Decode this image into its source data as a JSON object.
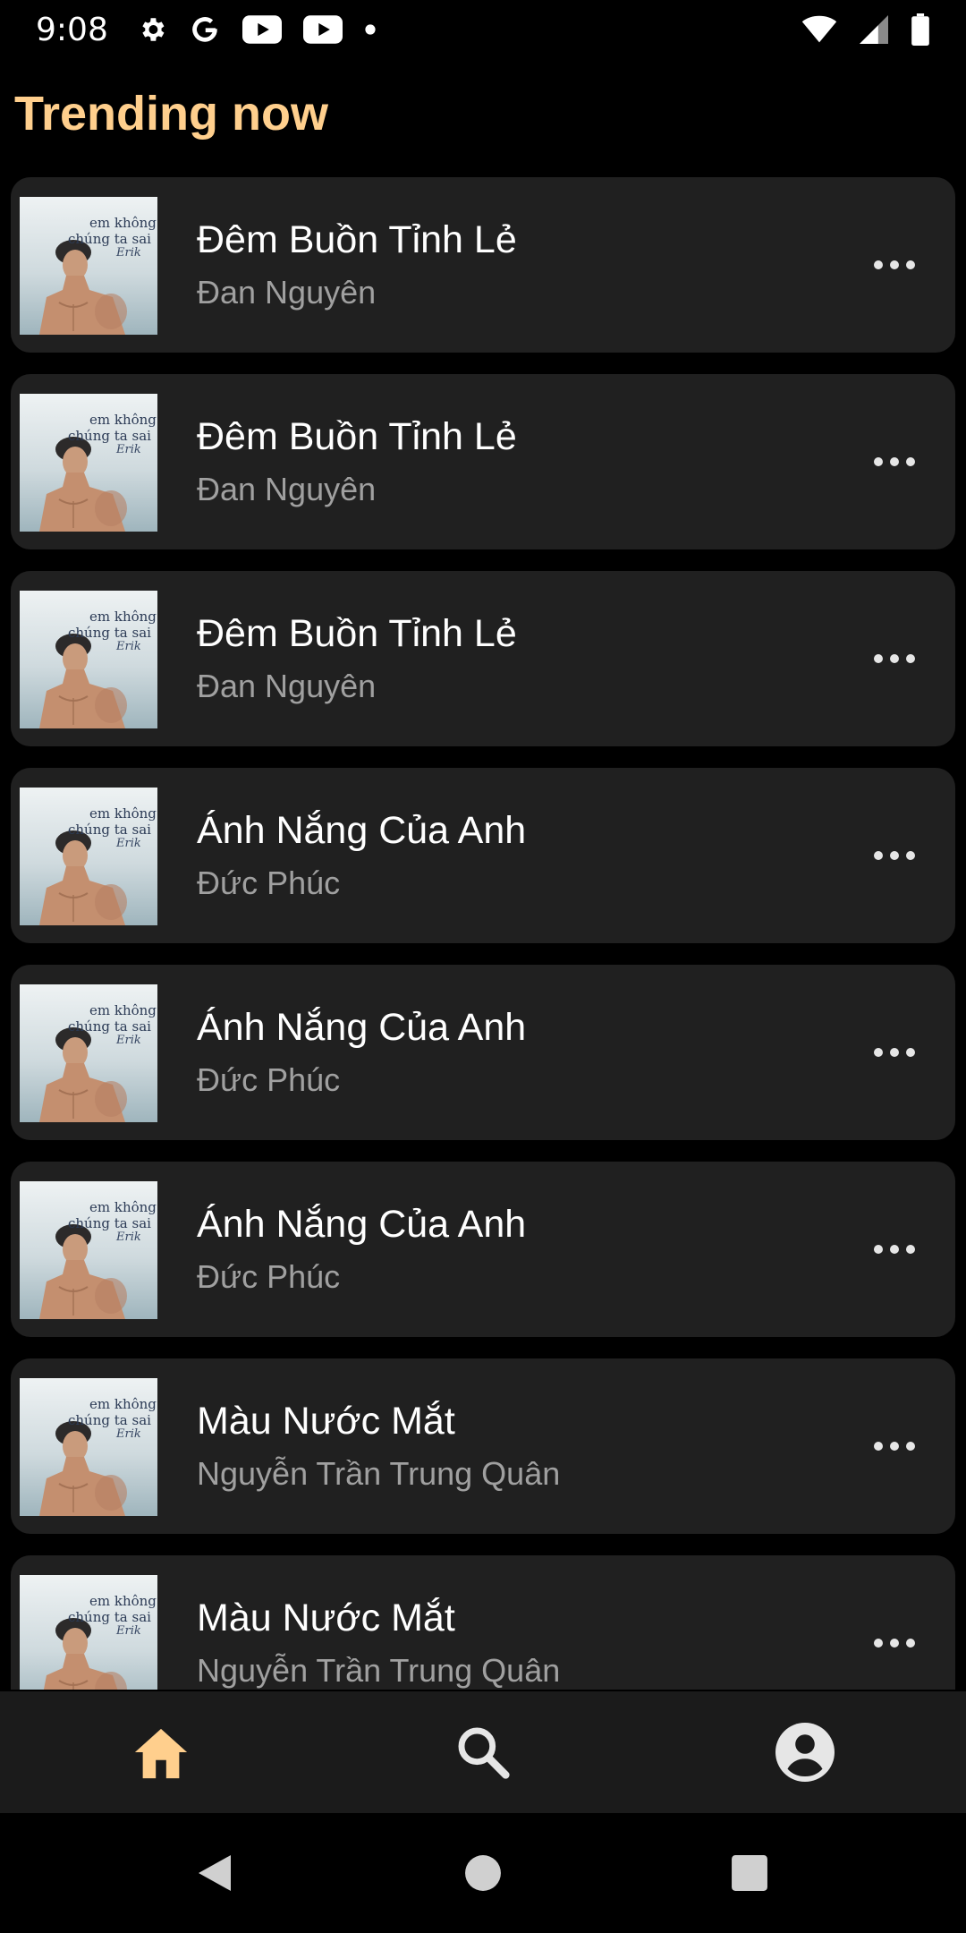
{
  "status_bar": {
    "time": "9:08",
    "icons_left": [
      "gear-icon",
      "google-icon",
      "youtube-icon",
      "youtube-icon",
      "dot-icon"
    ],
    "icons_right": [
      "wifi-icon",
      "signal-icon",
      "battery-icon"
    ]
  },
  "header": {
    "title": "Trending now"
  },
  "songs": [
    {
      "title": "Đêm Buồn Tỉnh Lẻ",
      "artist": "Đan Nguyên"
    },
    {
      "title": "Đêm Buồn Tỉnh Lẻ",
      "artist": "Đan Nguyên"
    },
    {
      "title": "Đêm Buồn Tỉnh Lẻ",
      "artist": "Đan Nguyên"
    },
    {
      "title": "Ánh Nắng Của Anh",
      "artist": "Đức Phúc"
    },
    {
      "title": "Ánh Nắng Của Anh",
      "artist": "Đức Phúc"
    },
    {
      "title": "Ánh Nắng Của Anh",
      "artist": "Đức Phúc"
    },
    {
      "title": "Màu Nước Mắt",
      "artist": "Nguyễn Trần Trung Quân"
    },
    {
      "title": "Màu Nước Mắt",
      "artist": "Nguyễn Trần Trung Quân"
    }
  ],
  "cover_art": {
    "text_line1": "em không sai",
    "text_line2": "chúng ta sai",
    "signature": "Erik"
  },
  "bottom_nav": {
    "items": [
      {
        "icon": "home-icon",
        "active": true
      },
      {
        "icon": "search-icon",
        "active": false
      },
      {
        "icon": "account-icon",
        "active": false
      }
    ]
  },
  "system_nav": {
    "items": [
      "back-icon",
      "home-circle-icon",
      "recents-icon"
    ]
  },
  "colors": {
    "accent": "#ffcf8d",
    "card": "#202020",
    "background": "#000000",
    "nav_bar": "#1b1b1b",
    "subtitle": "#a0a0a0",
    "icon_inactive": "#e6e6e6"
  }
}
